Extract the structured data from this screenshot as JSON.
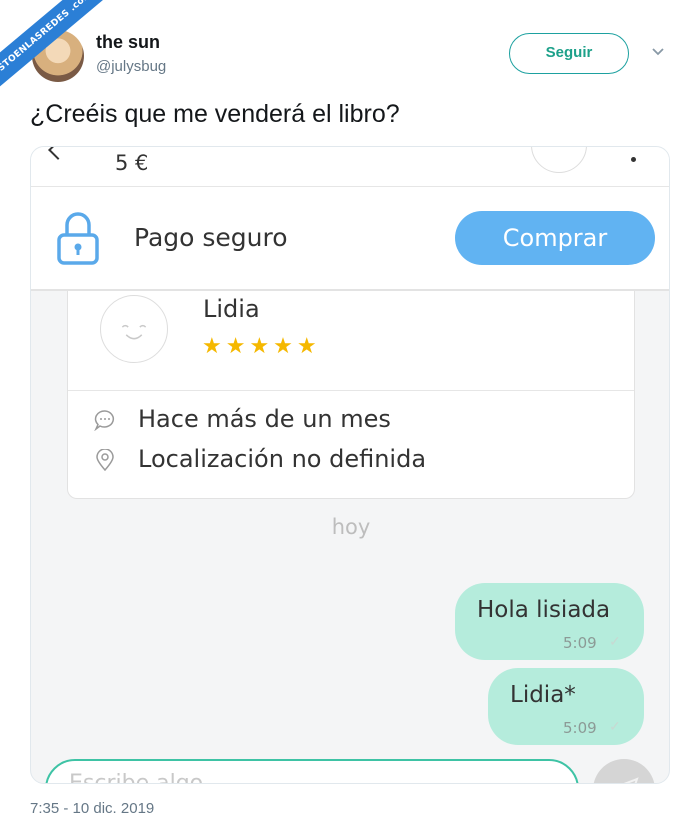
{
  "watermark": {
    "text": "VISTOENLASREDES .com"
  },
  "tweet": {
    "display_name": "the sun",
    "handle": "@julysbug",
    "follow_label": "Seguir",
    "text": "¿Creéis que me venderá el libro?",
    "timestamp": "7:35 - 10 dic. 2019"
  },
  "embedded": {
    "price": "5 €",
    "pay_label": "Pago seguro",
    "buy_label": "Comprar",
    "seller": {
      "name": "Lidia",
      "stars": "★★★★★",
      "rating": 5
    },
    "info": {
      "last_seen": "Hace más de un mes",
      "location": "Localización no definida"
    },
    "day_divider": "hoy",
    "messages": [
      {
        "text": "Hola lisiada",
        "time": "5:09"
      },
      {
        "text": "Lidia*",
        "time": "5:09"
      }
    ],
    "input_placeholder": "Escribe algo..."
  },
  "colors": {
    "follow": "#1da18a",
    "buy_button": "#61b3f2",
    "bubble": "#b5ecdc",
    "input_border": "#3ec3a5",
    "stars": "#f5b800"
  }
}
